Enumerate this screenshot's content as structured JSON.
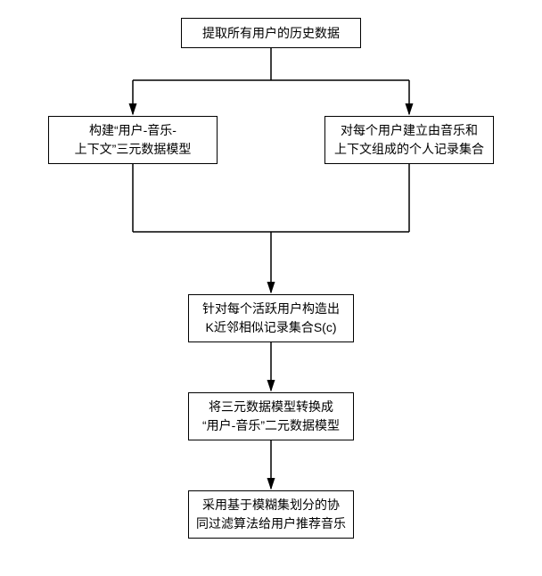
{
  "chart_data": {
    "type": "flowchart",
    "nodes": [
      {
        "id": "n1",
        "text": "提取所有用户的历史数据"
      },
      {
        "id": "n2",
        "text": "构建\"用户-音乐-上下文\"三元数据模型"
      },
      {
        "id": "n3",
        "text": "对每个用户建立由音乐和上下文组成的个人记录集合"
      },
      {
        "id": "n4",
        "text": "针对每个活跃用户构造出K近邻相似记录集合S(c)"
      },
      {
        "id": "n5",
        "text": "将三元数据模型转换成\"用户-音乐\"二元数据模型"
      },
      {
        "id": "n6",
        "text": "采用基于模糊集划分的协同过滤算法给用户推荐音乐"
      }
    ],
    "edges": [
      {
        "from": "n1",
        "to": "n2"
      },
      {
        "from": "n1",
        "to": "n3"
      },
      {
        "from": "n2",
        "to": "n4"
      },
      {
        "from": "n3",
        "to": "n4"
      },
      {
        "from": "n4",
        "to": "n5"
      },
      {
        "from": "n5",
        "to": "n6"
      }
    ]
  },
  "boxes": {
    "n1": "提取所有用户的历史数据",
    "n2_line1": "构建“用户-音乐-",
    "n2_line2": "上下文”三元数据模型",
    "n3_line1": "对每个用户建立由音乐和",
    "n3_line2": "上下文组成的个人记录集合",
    "n4_line1": "针对每个活跃用户构造出",
    "n4_line2": "K近邻相似记录集合S(c)",
    "n5_line1": "将三元数据模型转换成",
    "n5_line2": "“用户-音乐”二元数据模型",
    "n6_line1": "采用基于模糊集划分的协",
    "n6_line2": "同过滤算法给用户推荐音乐"
  }
}
